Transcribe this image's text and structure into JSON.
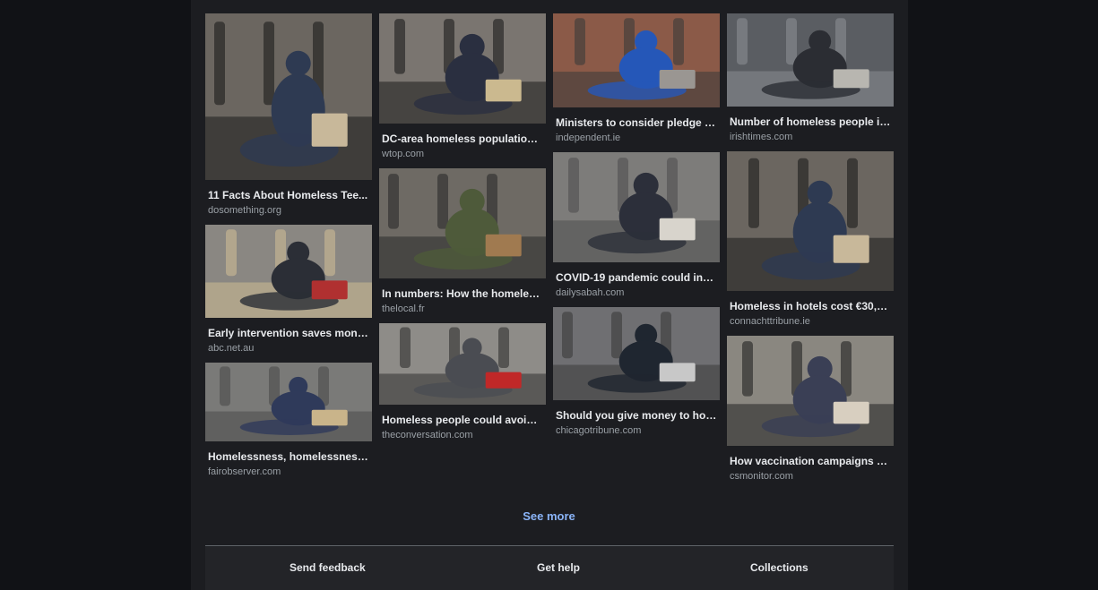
{
  "results": {
    "columns": [
      [
        {
          "title": "11 Facts About Homeless Tee...",
          "source": "dosomething.org",
          "image": "woman-with-dog-holding-sign-photo",
          "palette": [
            "#6b6660",
            "#2e3a52",
            "#c8b89a",
            "#1b1b1b"
          ]
        },
        {
          "title": "Early intervention saves mone...",
          "source": "abc.net.au",
          "image": "person-sitting-by-wall-with-sign-photo",
          "palette": [
            "#8a8782",
            "#2b2e36",
            "#b03030",
            "#cdbb94"
          ]
        },
        {
          "title": "Homelessness, homelessness...",
          "source": "fairobserver.com",
          "image": "man-sitting-on-sidewalk-with-sign-photo",
          "palette": [
            "#7a7a78",
            "#2f3a5a",
            "#c9b48a",
            "#4a4a4a"
          ]
        }
      ],
      [
        {
          "title": "DC-area homeless population f...",
          "source": "wtop.com",
          "image": "woman-with-dog-street-photo",
          "palette": [
            "#7a7570",
            "#2a2f40",
            "#cbb98f",
            "#1b1b1b"
          ]
        },
        {
          "title": "In numbers: How the homeles...",
          "source": "thelocal.fr",
          "image": "man-with-belongings-on-street-photo",
          "palette": [
            "#6e6a64",
            "#4e5a3a",
            "#a07a50",
            "#2a2a2a"
          ]
        },
        {
          "title": "Homeless people could avoid l...",
          "source": "theconversation.com",
          "image": "person-crouched-on-pavement-photo",
          "palette": [
            "#8e8c88",
            "#4a4c52",
            "#c02828",
            "#2f2f2f"
          ]
        }
      ],
      [
        {
          "title": "Ministers to consider pledge t...",
          "source": "independent.ie",
          "image": "sleeping-bag-on-street-photo",
          "palette": [
            "#8b5a48",
            "#2557b8",
            "#9a9692",
            "#3a3a3a"
          ]
        },
        {
          "title": "COVID-19 pandemic could incr...",
          "source": "dailysabah.com",
          "image": "group-sitting-on-ground-photo",
          "palette": [
            "#7d7c7a",
            "#2c2f3a",
            "#d8d4cc",
            "#4f4f4f"
          ]
        },
        {
          "title": "Should you give money to hom...",
          "source": "chicagotribune.com",
          "image": "pedestrians-at-bus-stop-photo",
          "palette": [
            "#6f6f72",
            "#1f2630",
            "#c8c8c8",
            "#3a3a3a"
          ]
        }
      ],
      [
        {
          "title": "Number of homeless people in...",
          "source": "irishtimes.com",
          "image": "man-sitting-by-wet-pavement-photo",
          "palette": [
            "#5a5d62",
            "#2b2d33",
            "#b8b6b0",
            "#8a8d92"
          ]
        },
        {
          "title": "Homeless in hotels cost €30,0...",
          "source": "connachttribune.ie",
          "image": "woman-with-dog-holding-sign-photo",
          "palette": [
            "#6b6660",
            "#2e3a52",
            "#c8b89a",
            "#1b1b1b"
          ]
        },
        {
          "title": "How vaccination campaigns ar...",
          "source": "csmonitor.com",
          "image": "vaccination-outreach-street-photo",
          "palette": [
            "#8a8780",
            "#3a3f55",
            "#d8cfc0",
            "#222222"
          ]
        }
      ]
    ],
    "see_more": "See more"
  },
  "footer": {
    "send_feedback": "Send feedback",
    "get_help": "Get help",
    "collections": "Collections"
  }
}
